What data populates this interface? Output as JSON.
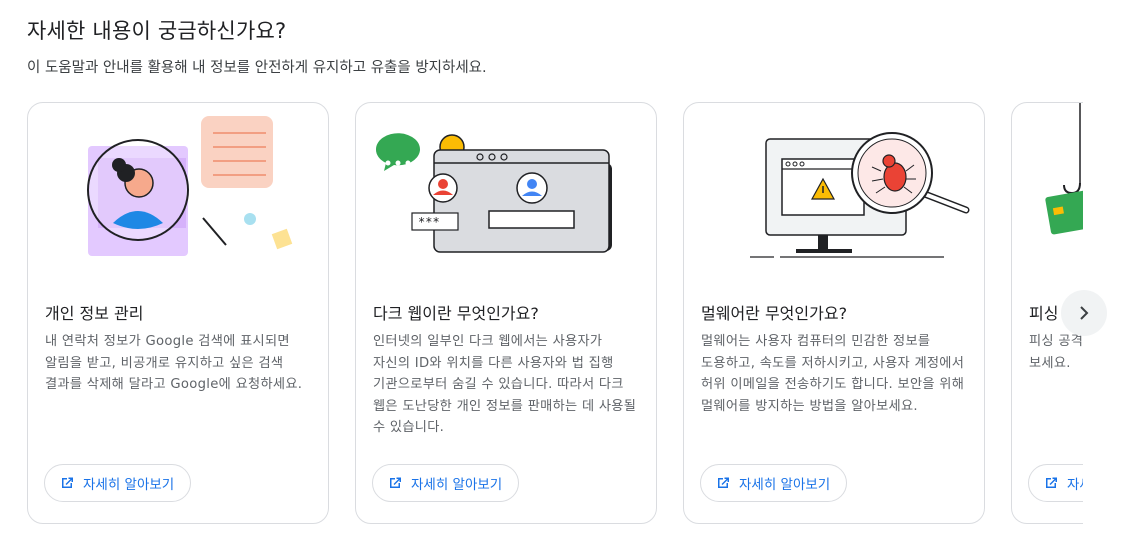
{
  "section": {
    "heading": "자세한 내용이 궁금하신가요?",
    "subheading": "이 도움말과 안내를 활용해 내 정보를 안전하게 유지하고 유출을 방지하세요."
  },
  "cards": [
    {
      "title": "개인 정보 관리",
      "description": "내 연락처 정보가 Google 검색에 표시되면 알림을 받고, 비공개로 유지하고 싶은 검색 결과를 삭제해 달라고 Google에 요청하세요.",
      "button_label": "자세히 알아보기",
      "icon": "magnifier-profile-illustration"
    },
    {
      "title": "다크 웹이란 무엇인가요?",
      "description": "인터넷의 일부인 다크 웹에서는 사용자가 자신의 ID와 위치를 다른 사용자와 법 집행 기관으로부터 숨길 수 있습니다. 따라서 다크 웹은 도난당한 개인 정보를 판매하는 데 사용될 수 있습니다.",
      "button_label": "자세히 알아보기",
      "icon": "dark-web-browser-illustration"
    },
    {
      "title": "멀웨어란 무엇인가요?",
      "description": "멀웨어는 사용자 컴퓨터의 민감한 정보를 도용하고, 속도를 저하시키고, 사용자 계정에서 허위 이메일을 전송하기도 합니다. 보안을 위해 멀웨어를 방지하는 방법을 알아보세요.",
      "button_label": "자세히 알아보기",
      "icon": "malware-bug-illustration"
    },
    {
      "title": "피싱",
      "description": "피싱 공격 ... 를 공유하 ... 이러한 공 ... 보세요.",
      "button_label": "자세히 알아보기",
      "icon": "phishing-hook-illustration"
    }
  ],
  "carousel": {
    "next_icon": "chevron-right-icon"
  },
  "colors": {
    "accent": "#1a73e8",
    "border": "#dadce0",
    "text_secondary": "#5f6368"
  }
}
